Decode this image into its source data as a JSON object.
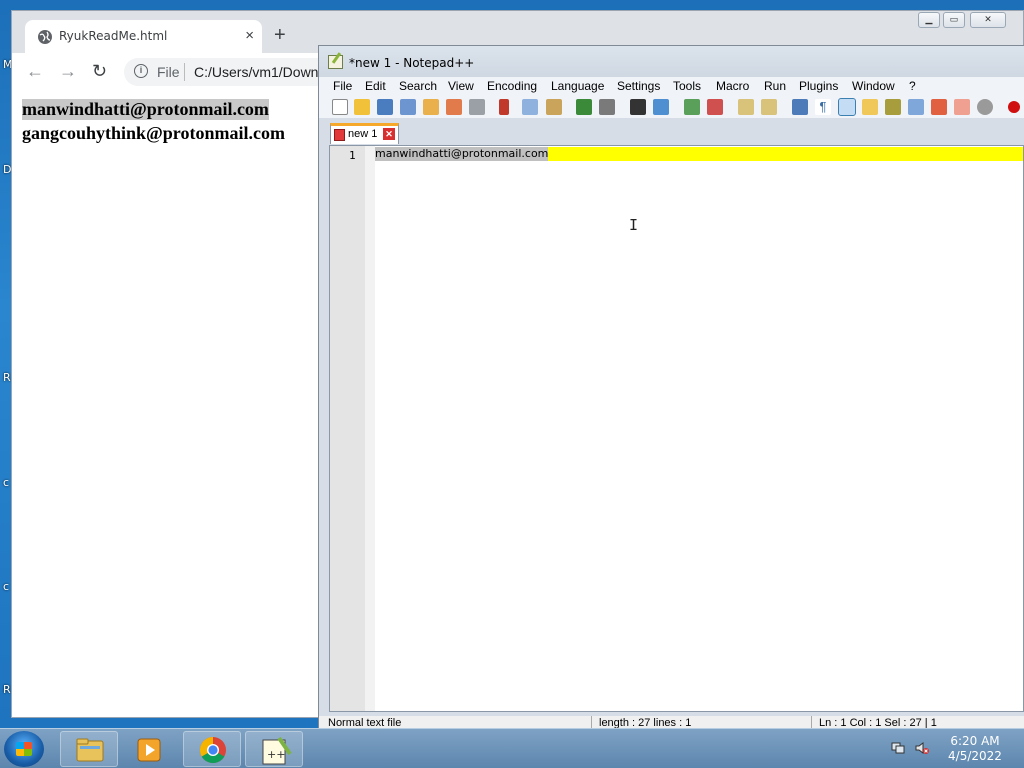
{
  "chrome": {
    "tab_title": "RyukReadMe.html",
    "tab_close": "×",
    "new_tab": "+",
    "nav_back": "←",
    "nav_forward": "→",
    "nav_reload": "↻",
    "address_scheme": "File",
    "address_url": "C:/Users/vm1/Down",
    "page_lines": [
      "manwindhatti@protonmail.com",
      "gangcouhythink@protonmail.com"
    ]
  },
  "desktop": {
    "edge_letters": [
      "M",
      "D",
      "R",
      "c",
      "c",
      "R"
    ]
  },
  "notepadpp": {
    "title": "*new 1 - Notepad++",
    "menu": [
      "File",
      "Edit",
      "Search",
      "View",
      "Encoding",
      "Language",
      "Settings",
      "Tools",
      "Macro",
      "Run",
      "Plugins",
      "Window",
      "?"
    ],
    "doc_tab": "new 1",
    "line_number": "1",
    "line_text": "manwindhatti@protonmail.com",
    "status": {
      "type": "Normal text file",
      "length": "length : 27    lines : 1",
      "position": "Ln : 1    Col : 1    Sel : 27 | 1"
    },
    "colors": {
      "current_line": "#ffff00",
      "selection": "#c0c0c0",
      "tab_accent": "#f6a82a"
    }
  },
  "taskbar": {
    "time": "6:20 AM",
    "date": "4/5/2022",
    "apps": [
      "explorer-icon",
      "media-player-icon",
      "chrome-icon",
      "notepadpp-icon"
    ]
  }
}
